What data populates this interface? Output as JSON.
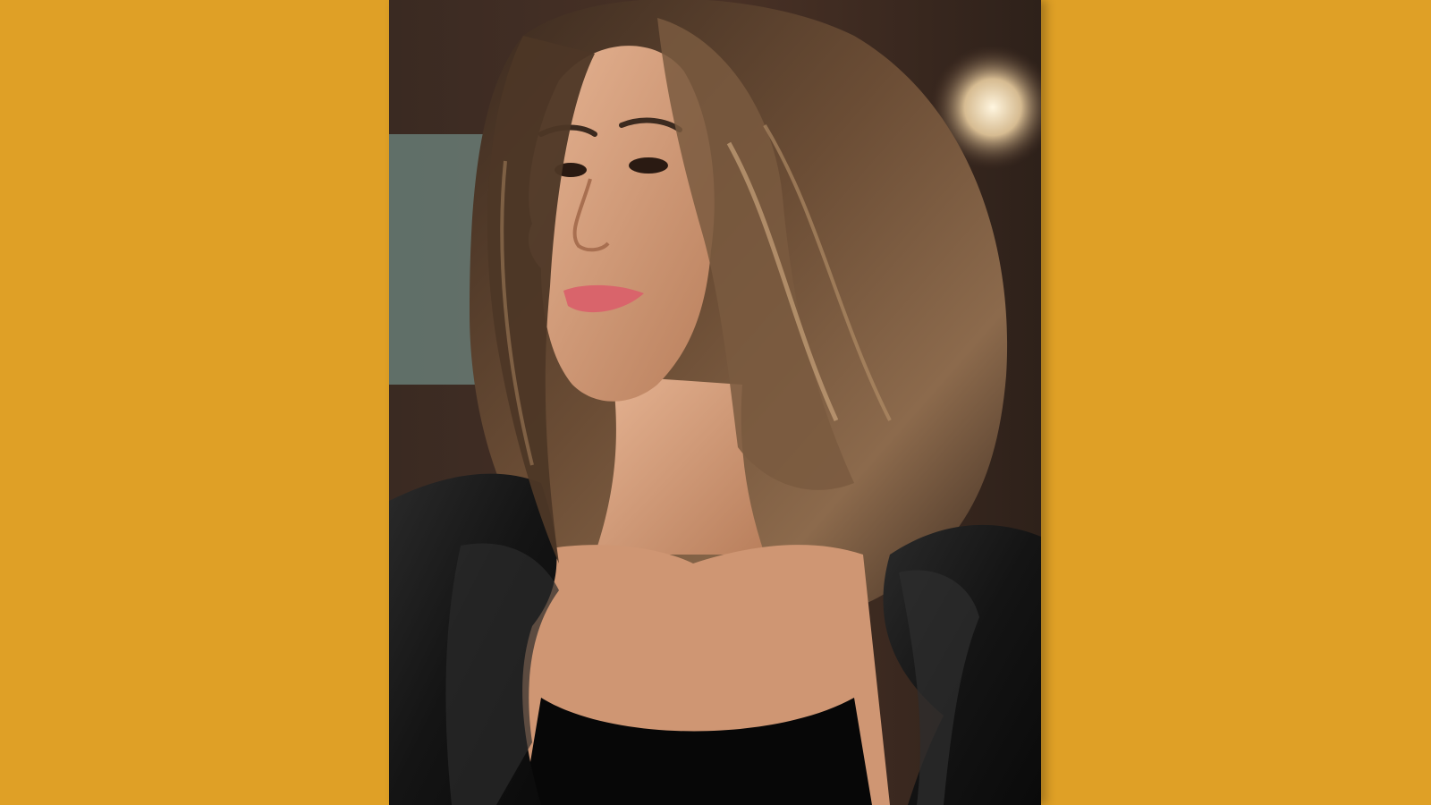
{
  "canvas": {
    "background_color": "#DFA026"
  },
  "photo": {
    "subject": "portrait-of-smiling-woman",
    "colors": {
      "background_dark": "#2a1c15",
      "background_warm": "#4a3226",
      "window_teal": "#7fa7a3",
      "lamp_glow": "#fff2d6",
      "hair_dark": "#3b2a1f",
      "hair_mid": "#6b4d35",
      "hair_highlight": "#b8926a",
      "skin": "#d9a37f",
      "skin_shadow": "#b97f5c",
      "lips": "#d9646b",
      "jacket": "#141414",
      "jacket_sheen": "#3a3a3a",
      "top": "#070707"
    }
  }
}
